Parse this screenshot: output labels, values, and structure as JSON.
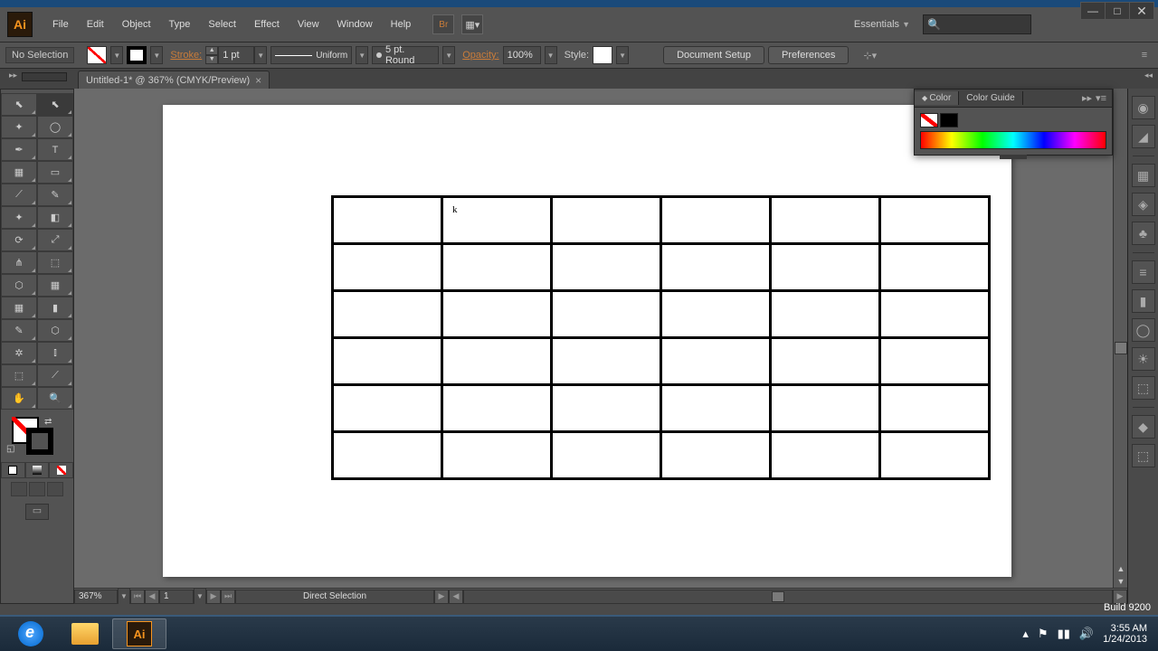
{
  "app": {
    "icon_text": "Ai"
  },
  "menu": [
    "File",
    "Edit",
    "Object",
    "Type",
    "Select",
    "Effect",
    "View",
    "Window",
    "Help"
  ],
  "workspace": {
    "label": "Essentials"
  },
  "controlbar": {
    "selection": "No Selection",
    "stroke_label": "Stroke:",
    "stroke_weight": "1 pt",
    "profile": "Uniform",
    "brush": "5 pt. Round",
    "opacity_label": "Opacity:",
    "opacity_value": "100%",
    "style_label": "Style:",
    "doc_setup": "Document Setup",
    "prefs": "Preferences"
  },
  "tab": {
    "title": "Untitled-1* @ 367% (CMYK/Preview)"
  },
  "statusbar": {
    "zoom": "367%",
    "artboard": "1",
    "hint": "Direct Selection"
  },
  "color_panel": {
    "tab1": "Color",
    "tab2": "Color Guide"
  },
  "canvas": {
    "cursor_char": "k"
  },
  "taskbar": {
    "build": "Build 9200",
    "time": "3:55 AM",
    "date": "1/24/2013"
  },
  "win_controls": {
    "min": "—",
    "max": "□",
    "close": "✕"
  },
  "tools": [
    "selection-tool",
    "direct-selection-tool",
    "magic-wand-tool",
    "lasso-tool",
    "pen-tool",
    "type-tool",
    "line-segment-tool",
    "rectangle-tool",
    "paintbrush-tool",
    "pencil-tool",
    "blob-brush-tool",
    "eraser-tool",
    "rotate-tool",
    "scale-tool",
    "width-tool",
    "free-transform-tool",
    "shape-builder-tool",
    "perspective-grid-tool",
    "mesh-tool",
    "gradient-tool",
    "eyedropper-tool",
    "blend-tool",
    "symbol-sprayer-tool",
    "column-graph-tool",
    "artboard-tool",
    "slice-tool",
    "hand-tool",
    "zoom-tool"
  ],
  "tool_glyphs": [
    "⬉",
    "⬉",
    "✦",
    "◯",
    "✒",
    "T",
    "▦",
    "▭",
    "⟋",
    "✎",
    "✦",
    "◧",
    "⟳",
    "⤢",
    "⋔",
    "⬚",
    "⬡",
    "▦",
    "▦",
    "▮",
    "✎",
    "⬡",
    "✲",
    "⫾",
    "⬚",
    "⟋",
    "✋",
    "🔍"
  ],
  "dock_icons": [
    "◉",
    "◢",
    "▦",
    "◈",
    "♣",
    "≡",
    "▮",
    "◯",
    "☀",
    "⬚",
    "◆",
    "⬚"
  ]
}
